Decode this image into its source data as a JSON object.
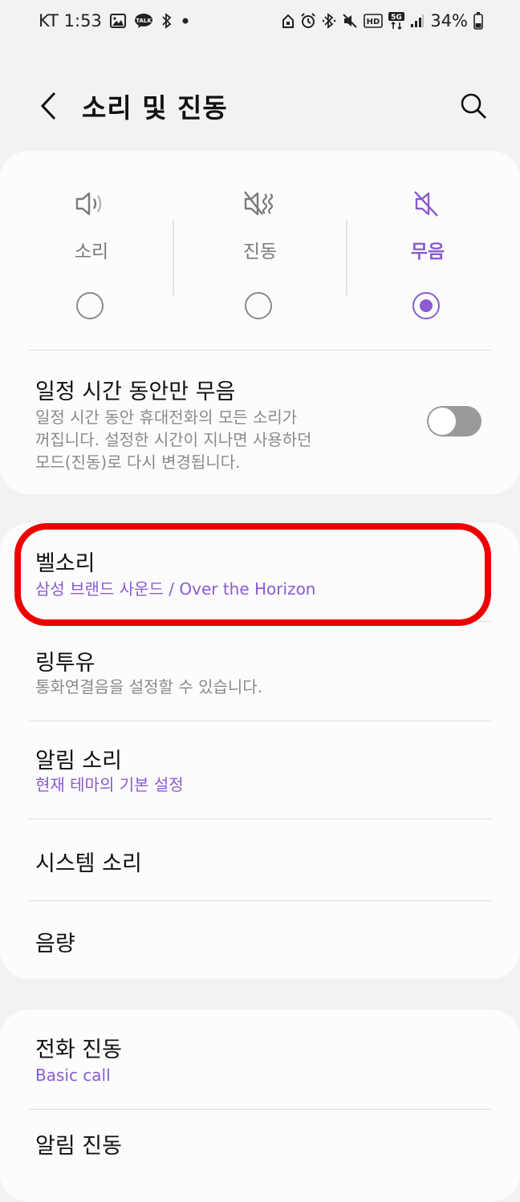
{
  "status_bar": {
    "carrier_time": "KT 1:53",
    "network_badge": "HD",
    "signal_badge": "5G",
    "battery": "34%",
    "icons": [
      "image-icon",
      "kakaotalk-icon",
      "bluetooth-icon",
      "dot-icon",
      "home-lock-icon",
      "alarm-icon",
      "bluetooth-icon",
      "mute-icon",
      "hd-icon",
      "5g-icon",
      "signal-icon",
      "battery-icon"
    ]
  },
  "header": {
    "title": "소리 및 진동",
    "back_icon": "chevron-left-icon",
    "search_icon": "search-icon"
  },
  "sound_modes": {
    "items": [
      {
        "label": "소리",
        "icon": "speaker-icon",
        "selected": false
      },
      {
        "label": "진동",
        "icon": "vibrate-icon",
        "selected": false
      },
      {
        "label": "무음",
        "icon": "mute-icon",
        "selected": true
      }
    ],
    "accent_color": "#8a5bd1"
  },
  "temporary_mute": {
    "title": "일정 시간 동안만 무음",
    "description_lines": [
      "일정 시간 동안 휴대전화의 모든 소리가",
      "꺼집니다. 설정한 시간이 지나면 사용하던",
      "모드(진동)로 다시 변경됩니다."
    ],
    "enabled": false
  },
  "settings": {
    "ringtone": {
      "title": "벨소리",
      "subtitle": "삼성 브랜드 사운드 / Over the Horizon"
    },
    "ringtoyou": {
      "title": "링투유",
      "subtitle": "통화연결음을 설정할 수 있습니다."
    },
    "notification_sound": {
      "title": "알림 소리",
      "subtitle": "현재 테마의 기본 설정"
    },
    "system_sound": {
      "title": "시스템 소리"
    },
    "volume": {
      "title": "음량"
    }
  },
  "vibration": {
    "call_vibration": {
      "title": "전화 진동",
      "subtitle": "Basic call"
    },
    "notification_vibration": {
      "title": "알림 진동"
    }
  },
  "annotation": {
    "highlight_color": "#ee0000"
  }
}
